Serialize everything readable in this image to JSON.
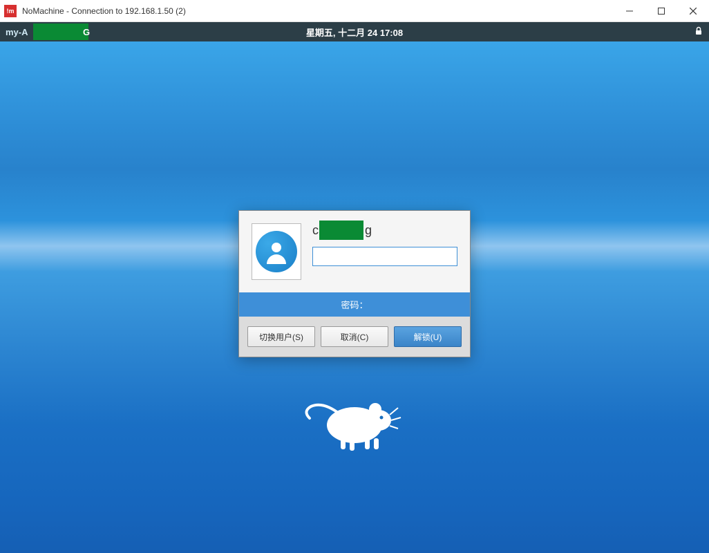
{
  "window": {
    "title": "NoMachine - Connection to 192.168.1.50 (2)",
    "icon_text": "!m"
  },
  "remote_bar": {
    "hostname_prefix": "my-A",
    "hostname_suffix": "G",
    "datetime": "星期五, 十二月 24  17:08"
  },
  "login": {
    "username_prefix": "c",
    "username_suffix": "g",
    "password_value": "",
    "label": "密码：",
    "switch_user": "切换用户(S)",
    "cancel": "取消(C)",
    "unlock": "解锁(U)"
  }
}
